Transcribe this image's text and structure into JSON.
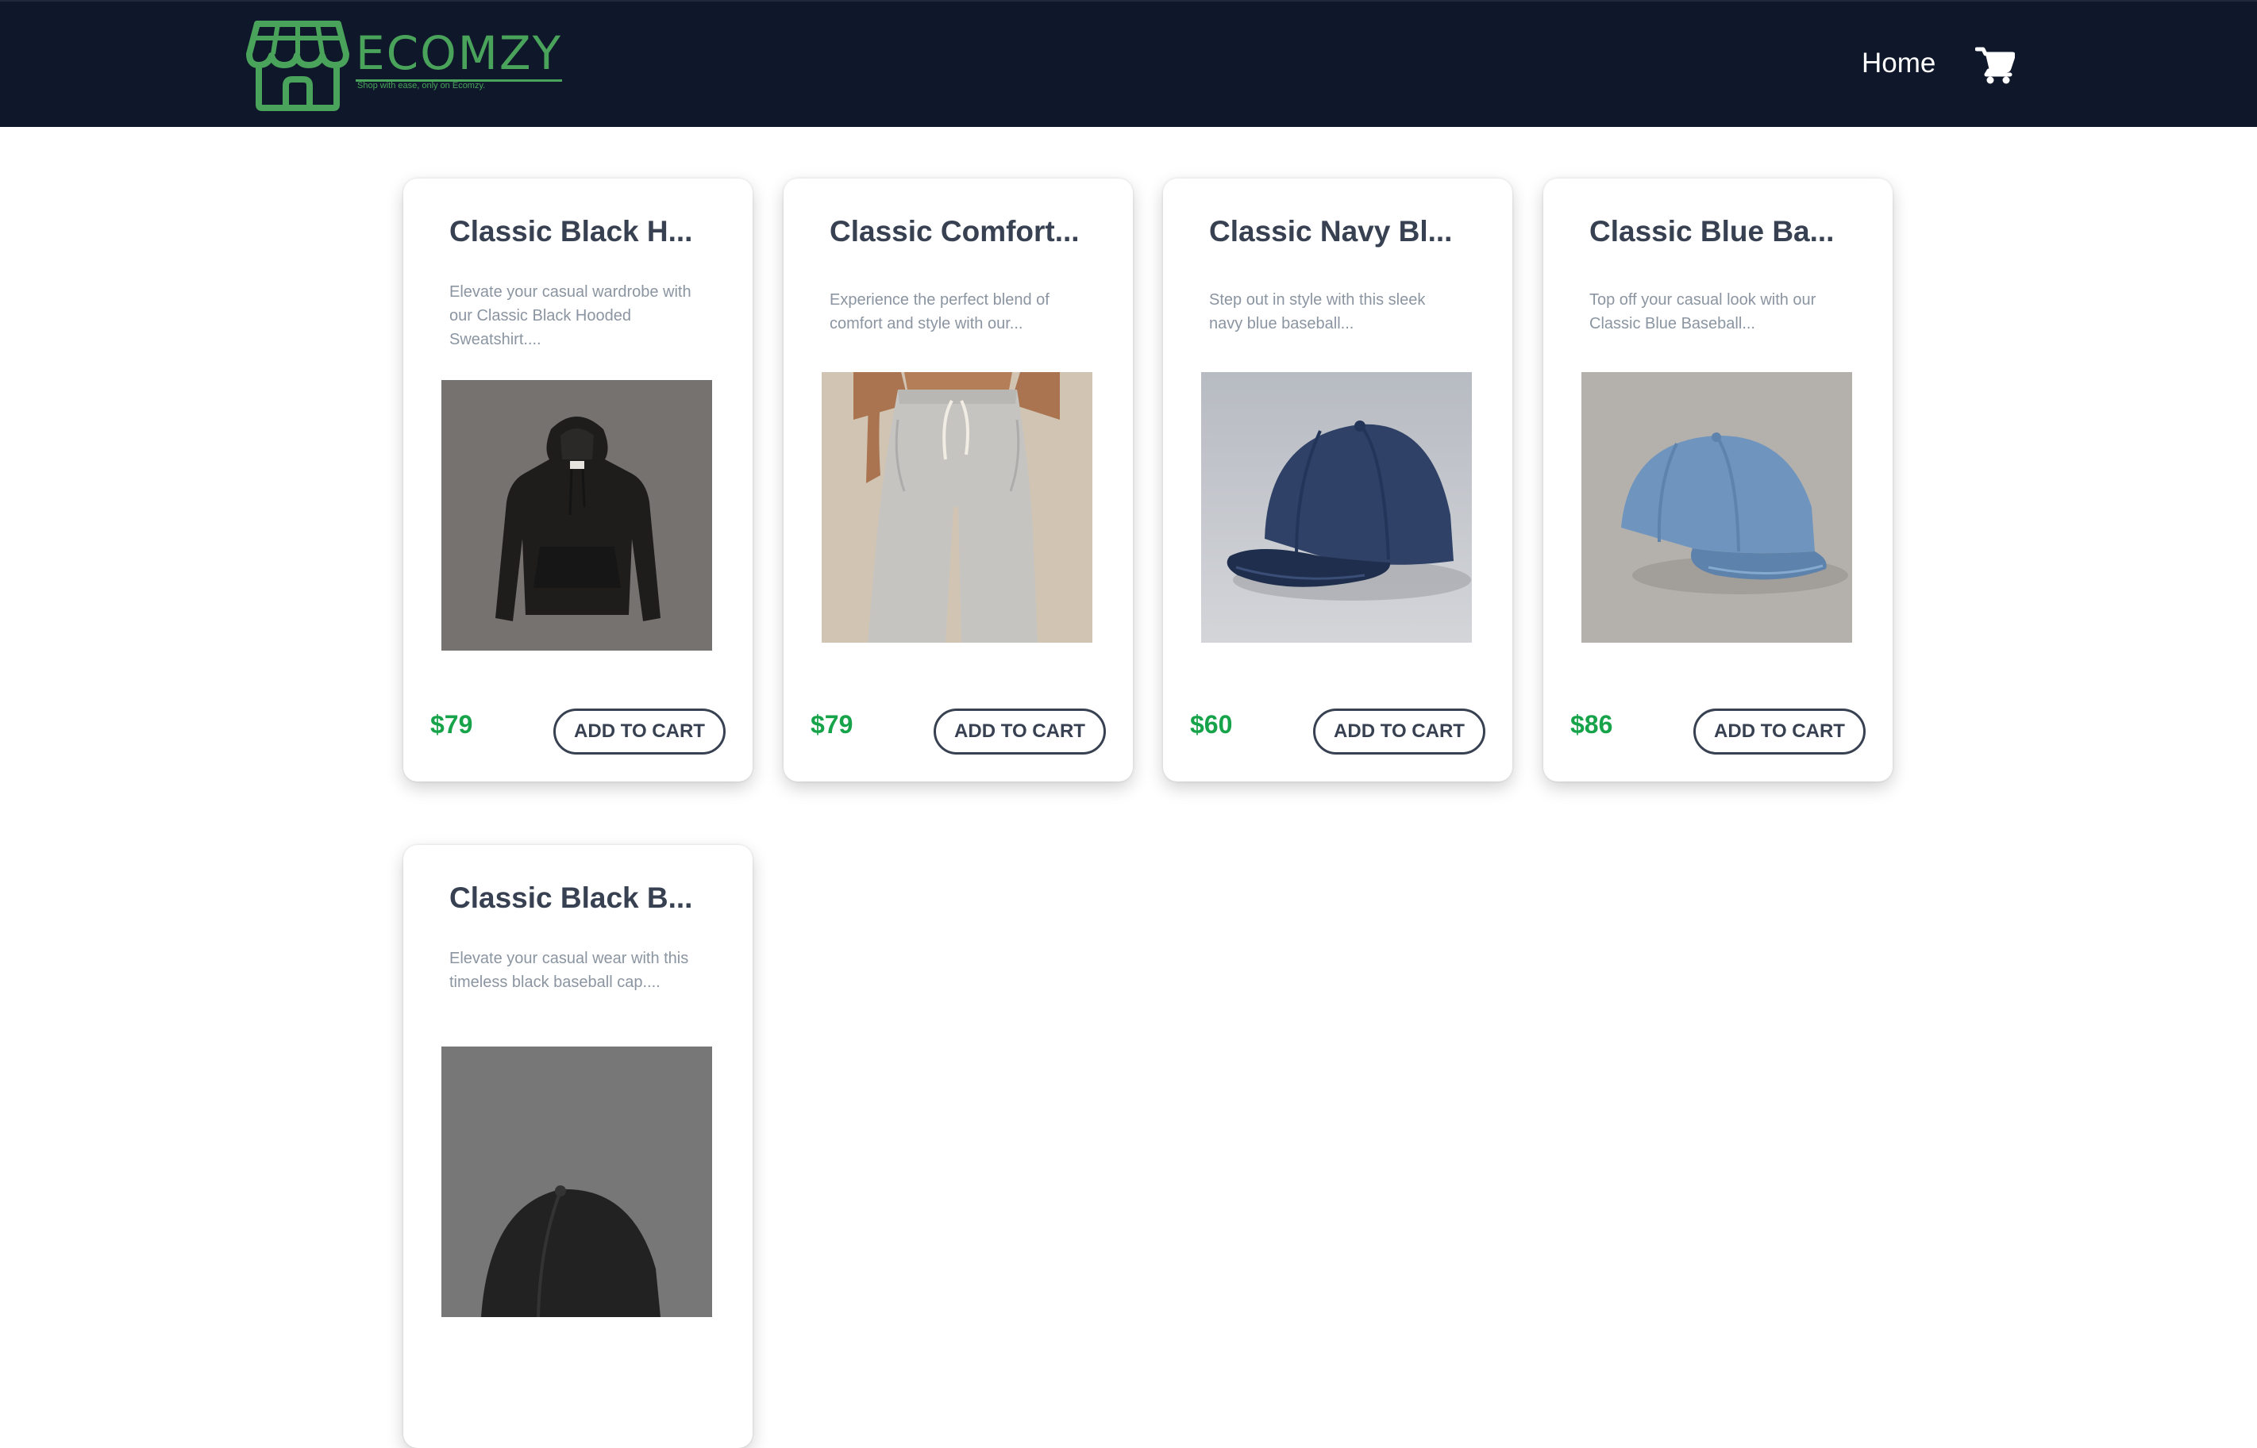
{
  "brand": {
    "name": "ECOMZY",
    "tagline": "Shop with ease, only on Ecomzy.",
    "color": "#4aa35b"
  },
  "nav": {
    "home_label": "Home",
    "cart_icon": "shopping-cart-icon"
  },
  "colors": {
    "navbar_bg": "#0f172a",
    "price": "#16a34a",
    "title": "#374151",
    "description": "#8b95a1"
  },
  "products": [
    {
      "title": "Classic Black H...",
      "description": "Elevate your casual wardrobe with our Classic Black Hooded Sweatshirt....",
      "price": "$79",
      "button_label": "ADD TO CART",
      "image": "black-hoodie"
    },
    {
      "title": "Classic Comfort...",
      "description": "Experience the perfect blend of comfort and style with our...",
      "price": "$79",
      "button_label": "ADD TO CART",
      "image": "grey-joggers"
    },
    {
      "title": "Classic Navy Bl...",
      "description": "Step out in style with this sleek navy blue baseball...",
      "price": "$60",
      "button_label": "ADD TO CART",
      "image": "navy-baseball-cap"
    },
    {
      "title": "Classic Blue Ba...",
      "description": "Top off your casual look with our Classic Blue Baseball...",
      "price": "$86",
      "button_label": "ADD TO CART",
      "image": "blue-baseball-cap"
    },
    {
      "title": "Classic Black B...",
      "description": "Elevate your casual wear with this timeless black baseball cap....",
      "price": "",
      "button_label": "",
      "image": "black-baseball-cap"
    }
  ]
}
